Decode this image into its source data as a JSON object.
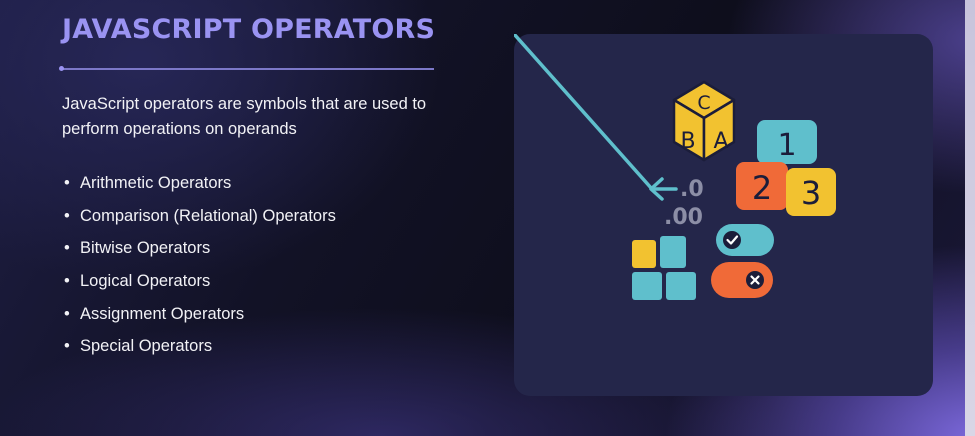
{
  "slide": {
    "title": "JAVASCRIPT OPERATORS",
    "intro": "JavaScript operators are symbols that are used to perform operations on operands",
    "bullets": [
      "Arithmetic Operators",
      "Comparison (Relational) Operators",
      "Bitwise Operators",
      "Logical Operators",
      "Assignment Operators",
      "Special Operators"
    ]
  },
  "illustration": {
    "cube_letters": [
      "C",
      "B",
      "A"
    ],
    "number_blocks": [
      "1",
      "2",
      "3"
    ],
    "decimal_top": ".0",
    "decimal_bottom": ".00",
    "arrow_icon": "left-arrow-icon",
    "toggle_on_icon": "check-icon",
    "toggle_off_icon": "close-icon"
  },
  "colors": {
    "title": "#9a93f2",
    "card_background": "#24264a",
    "yellow": "#f2c230",
    "teal": "#5fbfcc",
    "orange": "#f06a38",
    "navy": "#1b1d3a"
  }
}
